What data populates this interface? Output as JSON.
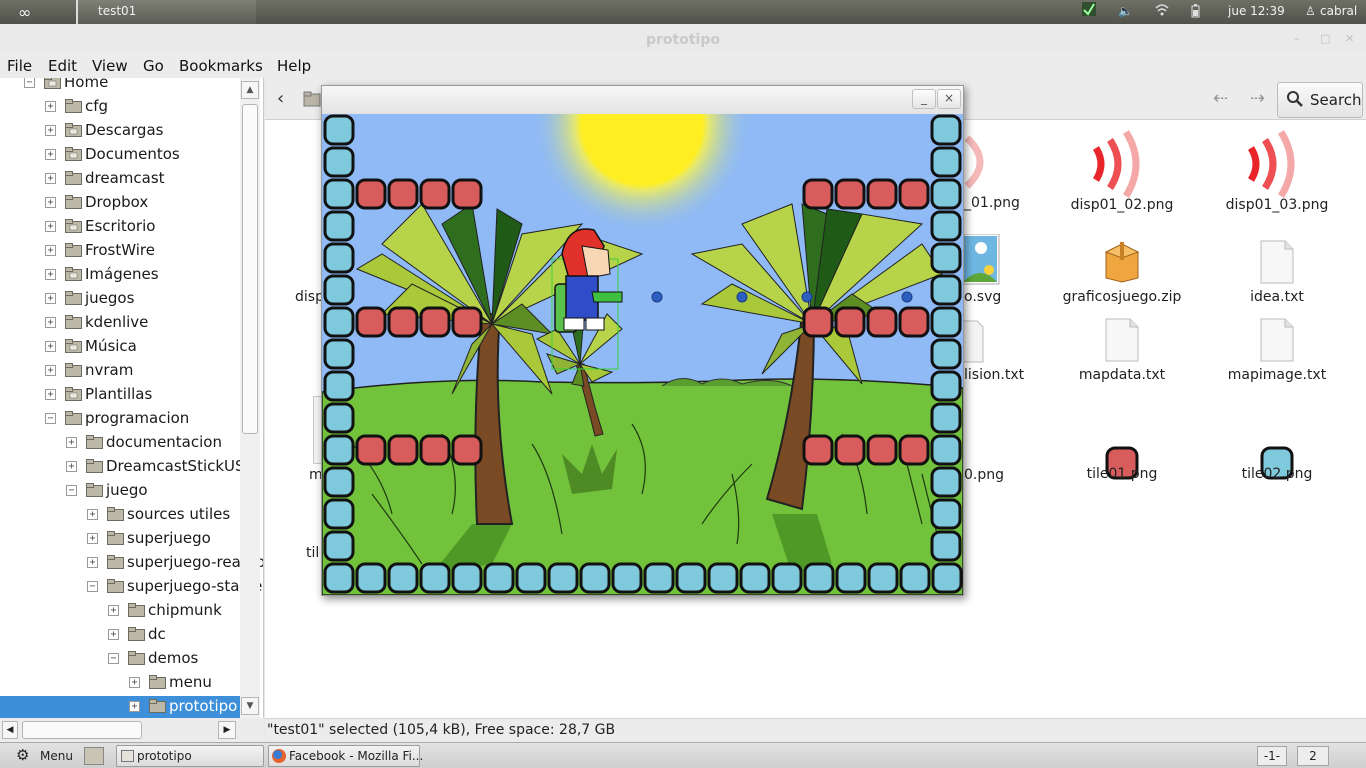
{
  "top_panel": {
    "window_title": "test01",
    "clock": "jue 12:39",
    "user": "cabral"
  },
  "window": {
    "title": "prototipo",
    "minimize": "–",
    "maximize": "□",
    "close": "✕"
  },
  "menubar": {
    "items": [
      "File",
      "Edit",
      "View",
      "Go",
      "Bookmarks",
      "Help"
    ]
  },
  "sidebar": {
    "items": [
      {
        "label": "Home",
        "expander": "−"
      },
      {
        "label": "cfg",
        "expander": "+"
      },
      {
        "label": "Descargas",
        "expander": "+"
      },
      {
        "label": "Documentos",
        "expander": "+"
      },
      {
        "label": "dreamcast",
        "expander": "+"
      },
      {
        "label": "Dropbox",
        "expander": "+"
      },
      {
        "label": "Escritorio",
        "expander": "+"
      },
      {
        "label": "FrostWire",
        "expander": "+"
      },
      {
        "label": "Imágenes",
        "expander": "+"
      },
      {
        "label": "juegos",
        "expander": "+"
      },
      {
        "label": "kdenlive",
        "expander": "+"
      },
      {
        "label": "Música",
        "expander": "+"
      },
      {
        "label": "nvram",
        "expander": "+"
      },
      {
        "label": "Plantillas",
        "expander": "+"
      },
      {
        "label": "programacion",
        "expander": "−"
      },
      {
        "label": "documentacion",
        "expander": "+"
      },
      {
        "label": "DreamcastStickUSB",
        "expander": "+"
      },
      {
        "label": "juego",
        "expander": "−"
      },
      {
        "label": "sources utiles",
        "expander": "+"
      },
      {
        "label": "superjuego",
        "expander": "+"
      },
      {
        "label": "superjuego-read-o",
        "expander": "+"
      },
      {
        "label": "superjuego-stable",
        "expander": "−"
      },
      {
        "label": "chipmunk",
        "expander": "+"
      },
      {
        "label": "dc",
        "expander": "+"
      },
      {
        "label": "demos",
        "expander": "−"
      },
      {
        "label": "menu",
        "expander": "+"
      },
      {
        "label": "prototipo",
        "expander": "+"
      }
    ]
  },
  "toolbar": {
    "search_label": "Search"
  },
  "files": [
    {
      "name": "disp01_02.png",
      "icon": "sound-waves-icon"
    },
    {
      "name": "disp01_03.png",
      "icon": "sound-waves-icon"
    },
    {
      "name": "graficosjuego.zip",
      "icon": "archive-icon"
    },
    {
      "name": "idea.txt",
      "icon": "text-file-icon"
    },
    {
      "name": "mapdata.txt",
      "icon": "text-file-icon"
    },
    {
      "name": "mapimage.txt",
      "icon": "text-file-icon"
    },
    {
      "name": "tile01.png",
      "icon": "red-tile-icon"
    },
    {
      "name": "tile02.png",
      "icon": "blue-tile-icon"
    }
  ],
  "partial_files": {
    "p1": "_01.png",
    "p2": "disp",
    "p3": "o.svg",
    "p4": "lision.txt",
    "p5": "m",
    "p6": "0.png",
    "p7": "til"
  },
  "statusbar": {
    "text": "\"test01\" selected (105,4 kB), Free space: 28,7 GB"
  },
  "taskbar": {
    "menu_label": "Menu",
    "tasks": [
      "prototipo",
      "Facebook - Mozilla Fi..."
    ],
    "workspaces": [
      "-1-",
      "2"
    ]
  },
  "game_window": {
    "minimize": "_",
    "close": "×",
    "colors": {
      "sky": "#8fbaf5",
      "grass": "#72c23b",
      "red_block": "#d95c5c",
      "blue_block": "#7fc9dc"
    }
  }
}
